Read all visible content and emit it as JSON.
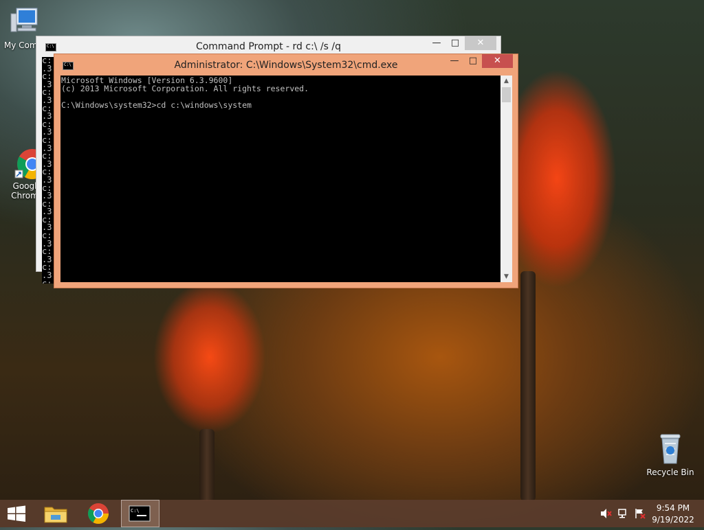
{
  "desktop": {
    "icons": [
      {
        "label": "My Comp",
        "icon": "computer-icon"
      },
      {
        "label": "Googl",
        "label2": "Chrom",
        "icon": "chrome-icon"
      },
      {
        "label": "Recycle Bin",
        "icon": "recycle-bin-icon"
      }
    ]
  },
  "back_window": {
    "title": "Command Prompt - rd  c:\\ /s /q",
    "console_lines": [
      "c:",
      ".3",
      "c:",
      ".3",
      "c:",
      ".3",
      "c:",
      ".3",
      "c:",
      ".3",
      "c:",
      ".3",
      "c:",
      ".3",
      "c:",
      ".3",
      "c:",
      ".3",
      "c:",
      ".3",
      "c:",
      ".3",
      "c:",
      ".3",
      "c:",
      ".3",
      "c:",
      ".3",
      "c:",
      ".3",
      "c:",
      ".3"
    ]
  },
  "front_window": {
    "title": "Administrator: C:\\Windows\\System32\\cmd.exe",
    "console_text": "Microsoft Windows [Version 6.3.9600]\n(c) 2013 Microsoft Corporation. All rights reserved.\n\nC:\\Windows\\system32>cd c:\\windows\\system"
  },
  "window_controls": {
    "minimize": "—",
    "maximize": "□",
    "close": "✕"
  },
  "taskbar": {
    "items": [
      {
        "name": "start-button",
        "icon": "windows-logo-icon"
      },
      {
        "name": "file-explorer-button",
        "icon": "folder-icon"
      },
      {
        "name": "chrome-button",
        "icon": "chrome-icon"
      },
      {
        "name": "cmd-button",
        "icon": "cmd-icon",
        "active": true
      }
    ],
    "tray": {
      "time": "9:54 PM",
      "date": "9/19/2022"
    }
  },
  "colors": {
    "front_frame": "#f0a47a",
    "close_button": "#c7504f",
    "console_bg": "#000000",
    "console_fg": "#c0c0c0"
  }
}
